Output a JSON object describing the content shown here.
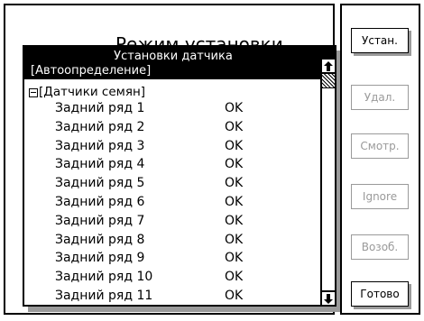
{
  "background": {
    "title": "Режим установки"
  },
  "dialog": {
    "title": "Установки датчика",
    "subtitle": "[Автоопределение]",
    "group_label": "[Датчики семян]",
    "items": [
      {
        "name": "Задний ряд 1",
        "status": "OK"
      },
      {
        "name": "Задний ряд 2",
        "status": "OK"
      },
      {
        "name": "Задний ряд 3",
        "status": "OK"
      },
      {
        "name": "Задний ряд 4",
        "status": "OK"
      },
      {
        "name": "Задний ряд 5",
        "status": "OK"
      },
      {
        "name": "Задний ряд 6",
        "status": "OK"
      },
      {
        "name": "Задний ряд 7",
        "status": "OK"
      },
      {
        "name": "Задний ряд 8",
        "status": "OK"
      },
      {
        "name": "Задний ряд 9",
        "status": "OK"
      },
      {
        "name": "Задний ряд 10",
        "status": "OK"
      },
      {
        "name": "Задний ряд 11",
        "status": "OK"
      }
    ]
  },
  "side_buttons": {
    "install": "Устан.",
    "delete": "Удал.",
    "view": "Смотр.",
    "ignore": "Ignore",
    "resume": "Возоб.",
    "done": "Готово"
  },
  "icons": {
    "collapse": "minus-box-icon",
    "scroll_up": "arrow-up-icon",
    "scroll_down": "arrow-down-icon"
  },
  "colors": {
    "header_bg": "#000000",
    "disabled_text": "#9a9a9a",
    "shadow": "#9a9a9a"
  }
}
